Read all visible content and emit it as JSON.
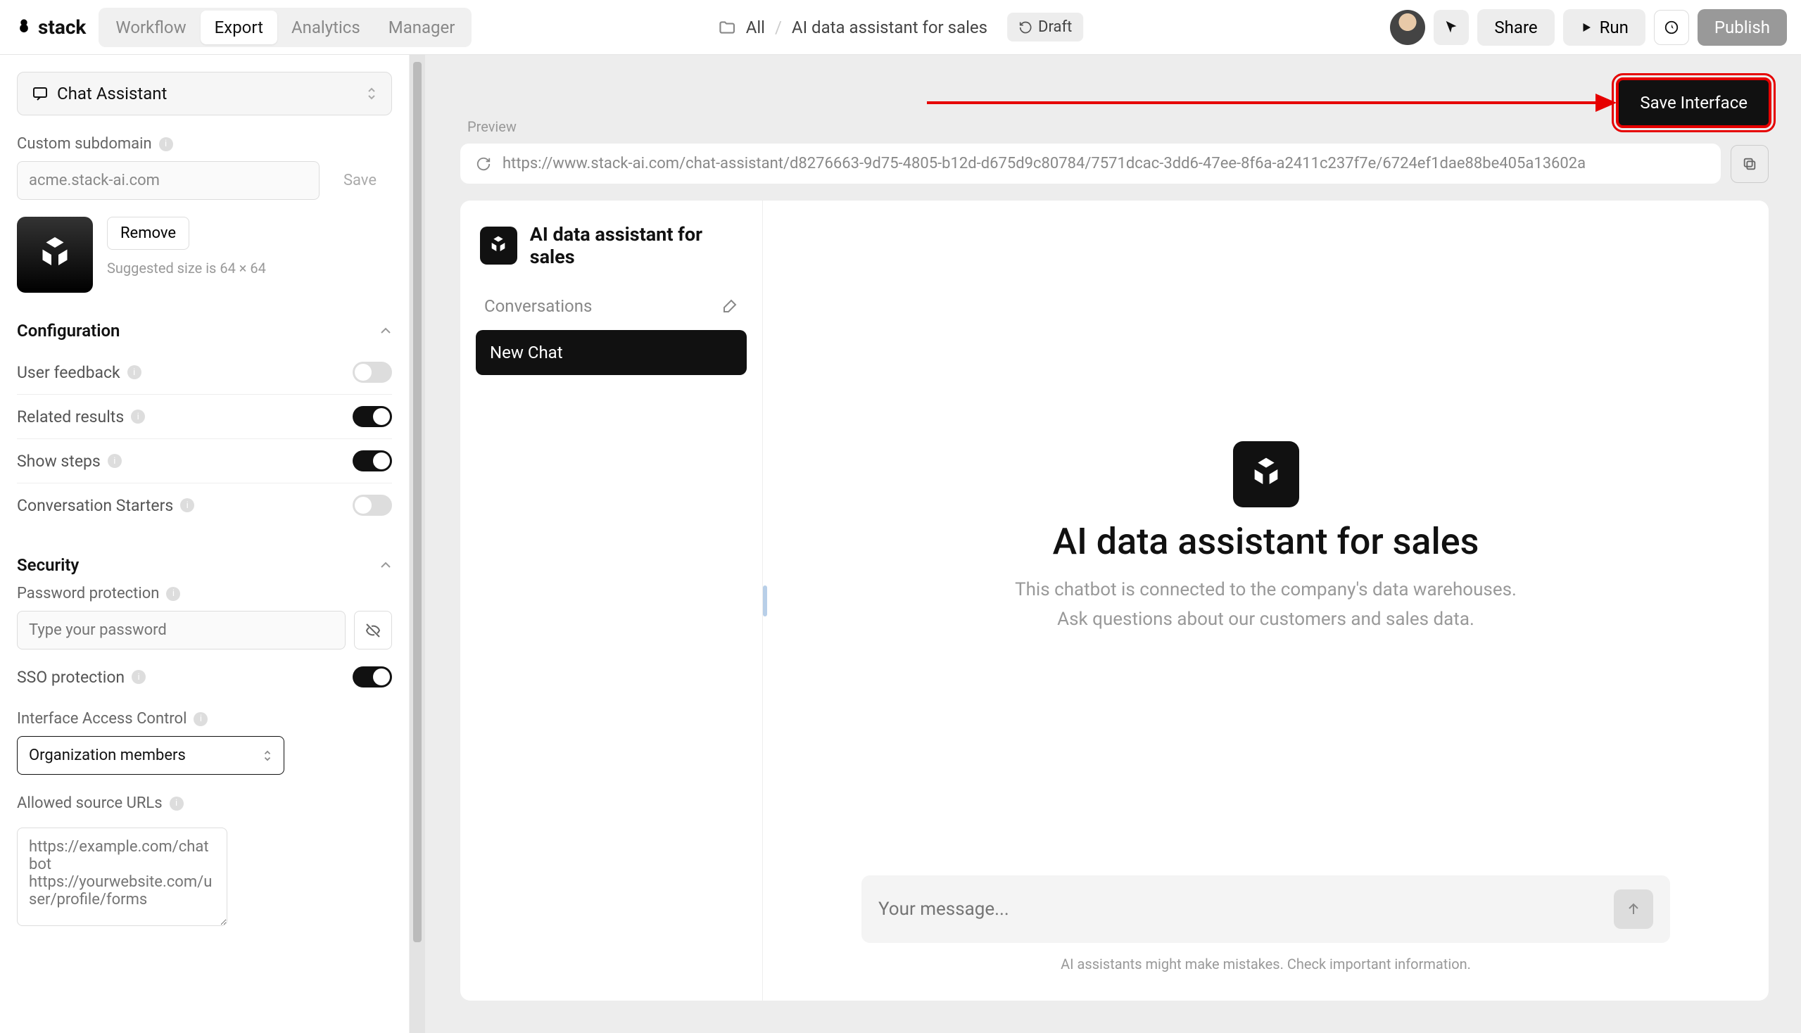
{
  "header": {
    "logo_text": "stack",
    "tabs": [
      "Workflow",
      "Export",
      "Analytics",
      "Manager"
    ],
    "active_tab": "Export",
    "breadcrumb_all": "All",
    "breadcrumb_current": "AI data assistant for sales",
    "draft_label": "Draft",
    "share_label": "Share",
    "run_label": "Run",
    "publish_label": "Publish"
  },
  "sidebar": {
    "interface_select": "Chat Assistant",
    "subdomain_label": "Custom subdomain",
    "subdomain_value": "acme.stack-ai.com",
    "save_label": "Save",
    "remove_label": "Remove",
    "logo_hint": "Suggested size is 64 × 64",
    "config_title": "Configuration",
    "config": {
      "user_feedback": {
        "label": "User feedback",
        "on": false
      },
      "related_results": {
        "label": "Related results",
        "on": true
      },
      "show_steps": {
        "label": "Show steps",
        "on": true
      },
      "conversation_starters": {
        "label": "Conversation Starters",
        "on": false
      }
    },
    "security_title": "Security",
    "security": {
      "pw_label": "Password protection",
      "pw_placeholder": "Type your password",
      "sso_label": "SSO protection",
      "sso_on": true,
      "iac_label": "Interface Access Control",
      "iac_value": "Organization members",
      "urls_label": "Allowed source URLs",
      "urls_placeholder": "https://example.com/chatbot\nhttps://yourwebsite.com/user/profile/forms"
    }
  },
  "main": {
    "save_interface_label": "Save Interface",
    "preview_label": "Preview",
    "url": "https://www.stack-ai.com/chat-assistant/d8276663-9d75-4805-b12d-d675d9c80784/7571dcac-3dd6-47ee-8f6a-a2411c237f7e/6724ef1dae88be405a13602a"
  },
  "chat": {
    "title": "AI data assistant for sales",
    "conversations_label": "Conversations",
    "new_chat_label": "New Chat",
    "big_title": "AI data assistant for sales",
    "desc_line1": "This chatbot is connected to the company's data warehouses.",
    "desc_line2": "Ask questions about our customers and sales data.",
    "msg_placeholder": "Your message...",
    "disclaimer": "AI assistants might make mistakes. Check important information."
  }
}
